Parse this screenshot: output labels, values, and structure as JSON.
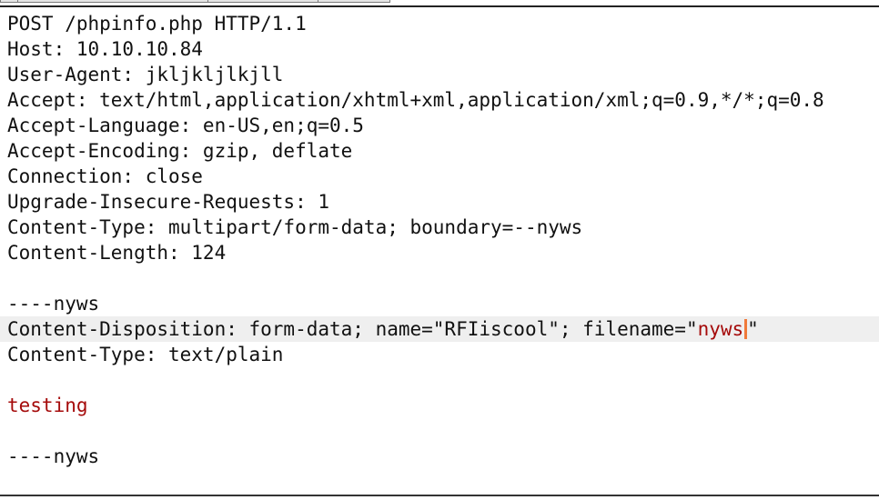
{
  "request": {
    "request_line": "POST /phpinfo.php HTTP/1.1",
    "headers": [
      "Host: 10.10.10.84",
      "User-Agent: jkljkljlkjll",
      "Accept: text/html,application/xhtml+xml,application/xml;q=0.9,*/*;q=0.8",
      "Accept-Language: en-US,en;q=0.5",
      "Accept-Encoding: gzip, deflate",
      "Connection: close",
      "Upgrade-Insecure-Requests: 1",
      "Content-Type: multipart/form-data; boundary=--nyws",
      "Content-Length: 124"
    ],
    "blank": "",
    "boundary_open": "----nyws",
    "disposition_prefix": "Content-Disposition: form-data; name=\"RFIiscool\"; filename=\"",
    "disposition_filename": "nyws",
    "disposition_suffix": "\"",
    "part_content_type": "Content-Type: text/plain",
    "body_value": "testing",
    "boundary_close": "----nyws"
  },
  "colors": {
    "text": "#111111",
    "value_highlight": "#a50b0b",
    "caret": "#f07a3a",
    "current_line": "#efefef"
  }
}
